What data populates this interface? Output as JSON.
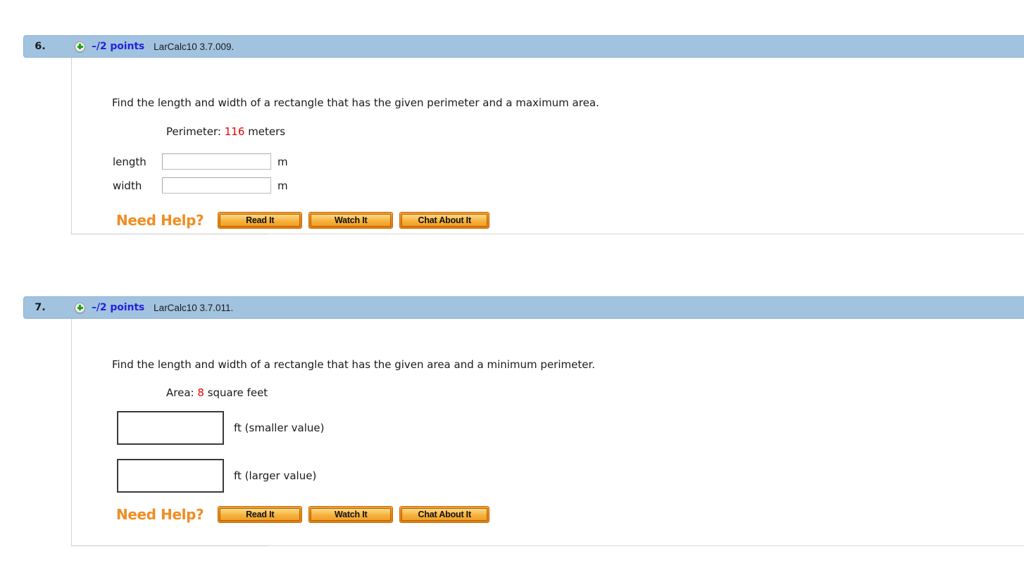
{
  "page": {
    "background": "#ffffff",
    "accent_orange": "#ef8d22",
    "header_blue": "#a2c3e0",
    "points_blue": "#2222dd",
    "value_red": "#ee0000"
  },
  "questions": [
    {
      "number": "6.",
      "expand_icon": "plus-circle-icon",
      "points": "–/2 points",
      "reference": "LarCalc10 3.7.009.",
      "prompt": "Find the length and width of a rectangle that has the given perimeter and a maximum area.",
      "given_label": "Perimeter:",
      "given_value": "116",
      "given_unit": "meters",
      "fields": [
        {
          "label": "length",
          "value": "",
          "unit": "m"
        },
        {
          "label": "width",
          "value": "",
          "unit": "m"
        }
      ],
      "help": {
        "label": "Need Help?",
        "buttons": [
          {
            "label": "Read It",
            "name": "read-it-button"
          },
          {
            "label": "Watch It",
            "name": "watch-it-button"
          },
          {
            "label": "Chat About It",
            "name": "chat-about-it-button"
          }
        ]
      }
    },
    {
      "number": "7.",
      "expand_icon": "plus-circle-icon",
      "points": "–/2 points",
      "reference": "LarCalc10 3.7.011.",
      "prompt": "Find the length and width of a rectangle that has the given area and a minimum perimeter.",
      "given_label": "Area:",
      "given_value": "8",
      "given_unit": "square feet",
      "fields": [
        {
          "label": "",
          "value": "",
          "unit": "ft (smaller value)"
        },
        {
          "label": "",
          "value": "",
          "unit": "ft (larger value)"
        }
      ],
      "help": {
        "label": "Need Help?",
        "buttons": [
          {
            "label": "Read It",
            "name": "read-it-button"
          },
          {
            "label": "Watch It",
            "name": "watch-it-button"
          },
          {
            "label": "Chat About It",
            "name": "chat-about-it-button"
          }
        ]
      }
    }
  ]
}
